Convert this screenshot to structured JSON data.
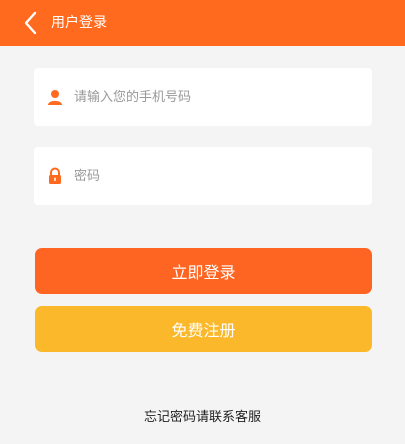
{
  "header": {
    "title": "用户登录",
    "back_icon": "chevron-left-icon",
    "background": "#ff6a1f"
  },
  "form": {
    "phone": {
      "icon": "user-icon",
      "placeholder": "请输入您的手机号码",
      "value": ""
    },
    "password": {
      "icon": "lock-icon",
      "placeholder": "密码",
      "value": ""
    }
  },
  "buttons": {
    "login_label": "立即登录",
    "login_color": "#ff6522",
    "register_label": "免费注册",
    "register_color": "#fbb82a"
  },
  "footer": {
    "forgot_text": "忘记密码请联系客服"
  }
}
